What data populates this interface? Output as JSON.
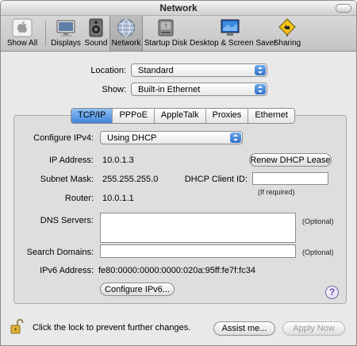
{
  "window": {
    "title": "Network"
  },
  "toolbar": {
    "items": [
      {
        "label": "Show All",
        "icon": "apple-logo-icon"
      },
      {
        "label": "Displays",
        "icon": "display-icon"
      },
      {
        "label": "Sound",
        "icon": "speaker-icon"
      },
      {
        "label": "Network",
        "icon": "globe-network-icon",
        "selected": true
      },
      {
        "label": "Startup Disk",
        "icon": "disk-icon"
      },
      {
        "label": "Desktop & Screen Saver",
        "icon": "desktop-icon"
      },
      {
        "label": "Sharing",
        "icon": "sharing-sign-icon"
      }
    ]
  },
  "location": {
    "label": "Location:",
    "value": "Standard"
  },
  "show": {
    "label": "Show:",
    "value": "Built-in Ethernet"
  },
  "tabs": [
    "TCP/IP",
    "PPPoE",
    "AppleTalk",
    "Proxies",
    "Ethernet"
  ],
  "active_tab": "TCP/IP",
  "tcpip": {
    "configure_label": "Configure IPv4:",
    "configure_value": "Using DHCP",
    "ip_label": "IP Address:",
    "ip_value": "10.0.1.3",
    "renew_button": "Renew DHCP Lease",
    "subnet_label": "Subnet Mask:",
    "subnet_value": "255.255.255.0",
    "client_id_label": "DHCP Client ID:",
    "client_id_value": "",
    "if_required": "(If required)",
    "router_label": "Router:",
    "router_value": "10.0.1.1",
    "dns_label": "DNS Servers:",
    "dns_value": "",
    "optional": "(Optional)",
    "search_label": "Search Domains:",
    "search_value": "",
    "ipv6_label": "IPv6 Address:",
    "ipv6_value": "fe80:0000:0000:0000:020a:95ff:fe7f:fc34",
    "configure_ipv6_button": "Configure IPv6...",
    "help": "?"
  },
  "footer": {
    "lock_text": "Click the lock to prevent further changes.",
    "assist_button": "Assist me...",
    "apply_button": "Apply Now"
  },
  "colors": {
    "accent": "#3f84d9",
    "help": "#5a3f9e"
  }
}
